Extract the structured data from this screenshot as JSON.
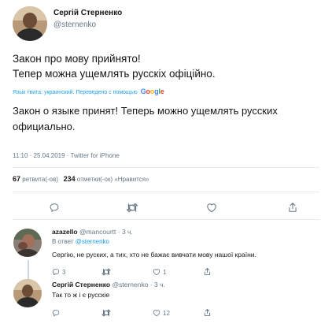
{
  "tweet": {
    "author_name": "Сергій Стерненко",
    "author_handle": "@sternenko",
    "text_line1": "Закон про мову прийнято!",
    "text_line2": "Тепер можна ущемлять русскіх офіційно.",
    "translate_label": "Язык твита: украинский. Переведено с помощью",
    "translate_brand": "Google",
    "translated_line1": "Закон о языке принят! Теперь можно ущемлять русских",
    "translated_line2": "официально.",
    "timestamp": "11:10 · 25.04.2019 · Twitter for iPhone",
    "retweet_count": "67",
    "retweet_label": "ретвита(-ов)",
    "like_count": "234",
    "like_label": "отметки(-ок) «Нравится»"
  },
  "replies": [
    {
      "author_name": "azazello",
      "author_handle": "@mancourtt · 3 ч.",
      "reply_to_prefix": "В ответ",
      "reply_to_handle": "@sternenko",
      "text": "Сергію, не руских, а тих, хто не бажає вивчати мову нашої країни.",
      "replies_count": "3",
      "retweets_count": "",
      "likes_count": "1"
    },
    {
      "author_name": "Сергій Стерненко",
      "author_handle": "@sternenko · 3 ч.",
      "text": "Так то ж і є русскіе",
      "replies_count": "",
      "retweets_count": "",
      "likes_count": "12"
    }
  ],
  "colors": {
    "accent": "#1da1f2",
    "muted": "#657786",
    "text": "#14171a",
    "divider": "#e6ecf0"
  },
  "icons": [
    "reply-icon",
    "retweet-icon",
    "like-icon",
    "share-icon"
  ]
}
